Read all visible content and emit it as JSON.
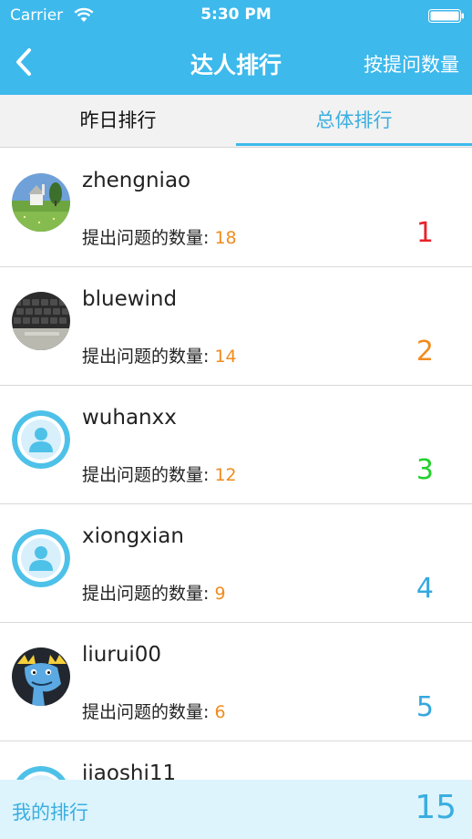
{
  "status_bar": {
    "carrier": "Carrier",
    "time": "5:30 PM"
  },
  "nav": {
    "title": "达人排行",
    "sort_label": "按提问数量",
    "back_icon": "chevron-left-icon"
  },
  "tabs": [
    {
      "label": "昨日排行",
      "selected": false
    },
    {
      "label": "总体排行",
      "selected": true
    }
  ],
  "list": {
    "count_prefix": "提出问题的数量: ",
    "rows": [
      {
        "username": "zhengniao",
        "count": "18",
        "rank": "1",
        "rank_color": "#e8222b",
        "avatar": "landscape-photo"
      },
      {
        "username": "bluewind",
        "count": "14",
        "rank": "2",
        "rank_color": "#f08c1e",
        "avatar": "keyboard-photo"
      },
      {
        "username": "wuhanxx",
        "count": "12",
        "rank": "3",
        "rank_color": "#22d02c",
        "avatar": "default-user-icon"
      },
      {
        "username": "xiongxian",
        "count": "9",
        "rank": "4",
        "rank_color": "#35a8df",
        "avatar": "default-user-icon"
      },
      {
        "username": "liurui00",
        "count": "6",
        "rank": "5",
        "rank_color": "#35a8df",
        "avatar": "moose-cartoon"
      },
      {
        "username": "jiaoshi11",
        "count": "",
        "rank": "",
        "rank_color": "#35a8df",
        "avatar": "default-user-icon"
      }
    ]
  },
  "my_rank": {
    "label": "我的排行",
    "value": "15"
  },
  "colors": {
    "accent": "#3db9ec",
    "count": "#f08c1e",
    "my_rank_bg": "#ddf4fd"
  }
}
